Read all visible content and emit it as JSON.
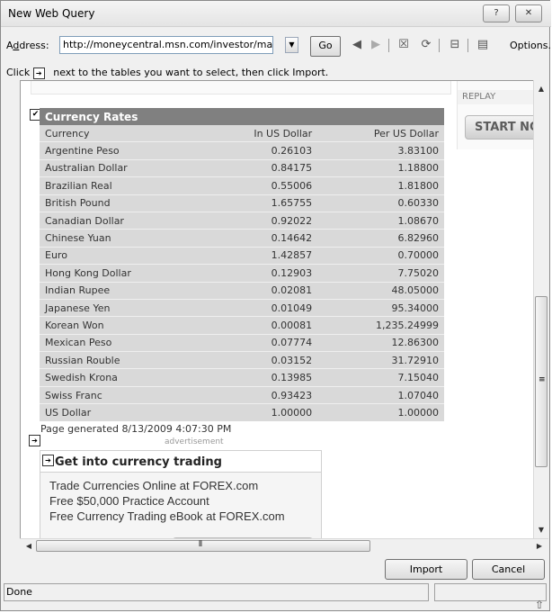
{
  "window": {
    "title": "New Web Query",
    "help_glyph": "?",
    "close_glyph": "✕"
  },
  "address": {
    "label_prefix": "A",
    "label_access": "d",
    "label_rest": "dress:",
    "url": "http://moneycentral.msn.com/investor/market/ex",
    "go_label": "Go",
    "options_label": "Options..."
  },
  "toolbar_icons": [
    "back-icon",
    "forward-icon",
    "stop-icon",
    "refresh-icon",
    "save-query-icon",
    "options-icon"
  ],
  "instruction": {
    "click_label": "Click",
    "text": "next to the tables you want to select, then click Import."
  },
  "replay": {
    "label": "REPLAY",
    "button": "START NOW"
  },
  "currency_table": {
    "title": "Currency Rates",
    "columns": [
      "Currency",
      "In US Dollar",
      "Per US Dollar"
    ],
    "rows": [
      {
        "currency": "Argentine Peso",
        "in_usd": "0.26103",
        "per_usd": "3.83100"
      },
      {
        "currency": "Australian Dollar",
        "in_usd": "0.84175",
        "per_usd": "1.18800"
      },
      {
        "currency": "Brazilian Real",
        "in_usd": "0.55006",
        "per_usd": "1.81800"
      },
      {
        "currency": "British Pound",
        "in_usd": "1.65755",
        "per_usd": "0.60330"
      },
      {
        "currency": "Canadian Dollar",
        "in_usd": "0.92022",
        "per_usd": "1.08670"
      },
      {
        "currency": "Chinese Yuan",
        "in_usd": "0.14642",
        "per_usd": "6.82960"
      },
      {
        "currency": "Euro",
        "in_usd": "1.42857",
        "per_usd": "0.70000"
      },
      {
        "currency": "Hong Kong Dollar",
        "in_usd": "0.12903",
        "per_usd": "7.75020"
      },
      {
        "currency": "Indian Rupee",
        "in_usd": "0.02081",
        "per_usd": "48.05000"
      },
      {
        "currency": "Japanese Yen",
        "in_usd": "0.01049",
        "per_usd": "95.34000"
      },
      {
        "currency": "Korean Won",
        "in_usd": "0.00081",
        "per_usd": "1,235.24999"
      },
      {
        "currency": "Mexican Peso",
        "in_usd": "0.07774",
        "per_usd": "12.86300"
      },
      {
        "currency": "Russian Rouble",
        "in_usd": "0.03152",
        "per_usd": "31.72910"
      },
      {
        "currency": "Swedish Krona",
        "in_usd": "0.13985",
        "per_usd": "7.15040"
      },
      {
        "currency": "Swiss Franc",
        "in_usd": "0.93423",
        "per_usd": "1.07040"
      },
      {
        "currency": "US Dollar",
        "in_usd": "1.00000",
        "per_usd": "1.00000"
      }
    ]
  },
  "page_generated": "Page generated 8/13/2009 4:07:30 PM",
  "advertisement": {
    "label": "advertisement",
    "title": "Get into currency trading",
    "lines": [
      "Trade Currencies Online at FOREX.com",
      "Free $50,000 Practice Account",
      "Free Currency Trading eBook at FOREX.com"
    ]
  },
  "buttons": {
    "import": "Import",
    "cancel": "Cancel"
  },
  "status": {
    "text": "Done"
  },
  "colors": {
    "table_header": "#808080",
    "table_row": "#d9d9d9"
  }
}
